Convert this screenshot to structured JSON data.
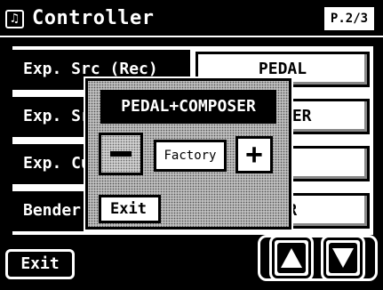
{
  "header": {
    "title": "Controller",
    "icon": "music-note-icon",
    "icon_glyph": "♫",
    "page_indicator": "P.2/3"
  },
  "rows": [
    {
      "label": "Exp. Src (Rec)",
      "value": "PEDAL"
    },
    {
      "label": "Exp. Sr",
      "value": "MPOSER"
    },
    {
      "label": "Exp. Cu",
      "value": ""
    },
    {
      "label": "Bender.",
      "value": "PER"
    }
  ],
  "footer": {
    "exit_label": "Exit",
    "up_icon": "up-arrow-icon",
    "down_icon": "down-arrow-icon"
  },
  "popup": {
    "title": "PEDAL+COMPOSER",
    "minus_label": "",
    "factory_label": "Factory",
    "plus_label": "+",
    "exit_label": "Exit"
  },
  "colors": {
    "background": "#000000",
    "foreground": "#ffffff",
    "popup_bg": "#bfbfbf"
  }
}
